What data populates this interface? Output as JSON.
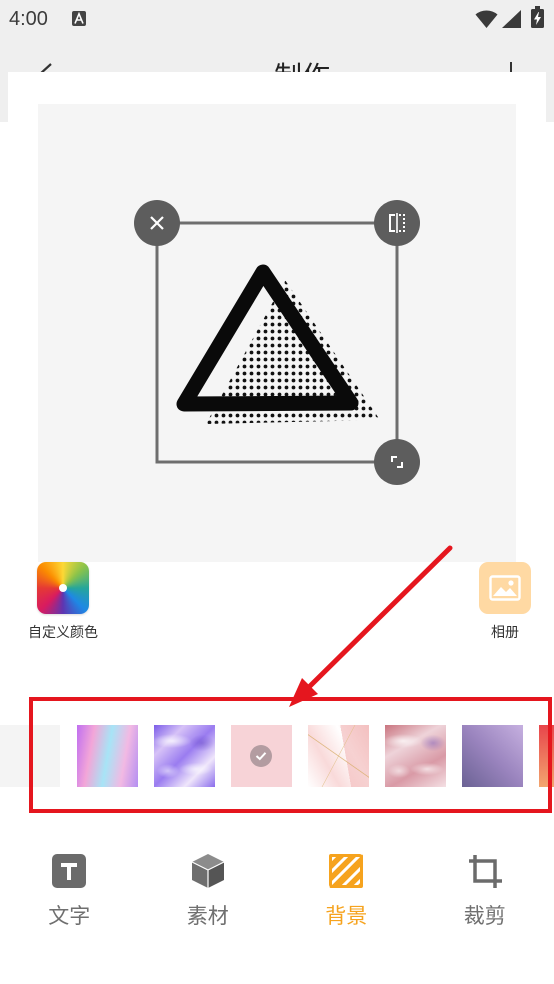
{
  "status_bar": {
    "time": "4:00",
    "icons": [
      "a-notification-icon",
      "wifi-icon",
      "cell-signal-icon",
      "battery-charging-icon"
    ]
  },
  "header": {
    "title": "制作",
    "back_icon": "chevron-left-icon",
    "right_icon": "plus-icon"
  },
  "canvas": {
    "handles": {
      "top_left": "close-icon",
      "top_right": "flip-horizontal-icon",
      "bottom_right": "resize-icon"
    }
  },
  "color_sources": {
    "custom_color": {
      "label": "自定义颜色",
      "icon": "color-wheel-icon"
    },
    "album": {
      "label": "相册",
      "icon": "image-icon",
      "color": "#ffd9a3"
    }
  },
  "backgrounds": {
    "items": [
      {
        "colors": [
          "#f4f4f4",
          "#f4f4f4"
        ],
        "selected": false
      },
      {
        "colors": [
          "#c06ff0",
          "#f3a6d8",
          "#a7e4f6",
          "#f2b9e3",
          "#b48ff2"
        ],
        "selected": false
      },
      {
        "colors": [
          "#7b5ce8",
          "#d6c2f7",
          "#9a7cf0",
          "#efe6fb",
          "#8a6cec"
        ],
        "selected": false
      },
      {
        "colors": [
          "#f7d3d7",
          "#f7d3d7"
        ],
        "selected": true
      },
      {
        "colors": [
          "#ffffff",
          "#f9dada",
          "#ffffff",
          "#f3c5c5"
        ],
        "selected": false
      },
      {
        "colors": [
          "#c9747f",
          "#eed3d9",
          "#d99aa6",
          "#f4e0e4"
        ],
        "selected": false
      },
      {
        "colors": [
          "#c6b0e0",
          "#9a84be",
          "#6b6294"
        ],
        "selected": false
      },
      {
        "colors": [
          "#e8454b",
          "#f2a66f"
        ],
        "selected": false
      }
    ]
  },
  "tabs": [
    {
      "label": "文字",
      "icon": "text-icon",
      "active": false
    },
    {
      "label": "素材",
      "icon": "cube-icon",
      "active": false
    },
    {
      "label": "背景",
      "icon": "background-stripes-icon",
      "active": true
    },
    {
      "label": "裁剪",
      "icon": "crop-icon",
      "active": false
    }
  ],
  "colors": {
    "accent": "#f6a31e",
    "tab_inactive": "#6f6f6f",
    "annotation": "#e5161e",
    "canvas_background": "#f5f5f5"
  }
}
